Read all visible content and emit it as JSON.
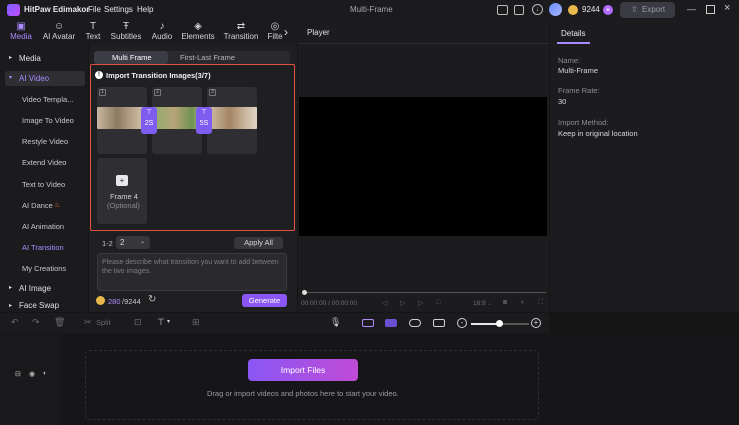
{
  "titlebar": {
    "app_name": "HitPaw Edimakor",
    "menus": [
      "File",
      "Settings",
      "Help"
    ],
    "doc_title": "Multi-Frame",
    "credits": "9244",
    "export_label": "Export"
  },
  "toolbar": {
    "tools": [
      {
        "label": "Media",
        "icon": "media-icon"
      },
      {
        "label": "AI Avatar",
        "icon": "avatar-icon"
      },
      {
        "label": "Text",
        "icon": "text-icon"
      },
      {
        "label": "Subtitles",
        "icon": "subtitles-icon"
      },
      {
        "label": "Audio",
        "icon": "audio-icon"
      },
      {
        "label": "Elements",
        "icon": "elements-icon"
      },
      {
        "label": "Transition",
        "icon": "transition-icon"
      },
      {
        "label": "Filte",
        "icon": "filter-icon"
      }
    ]
  },
  "sidebar": {
    "categories": [
      "Media",
      "AI Video",
      "AI Image",
      "Face Swap"
    ],
    "items": [
      "Video Templa...",
      "Image To Video",
      "Restyle Video",
      "Extend Video",
      "Text to Video",
      "AI Dance",
      "AI Animation",
      "AI Transition",
      "My Creations"
    ]
  },
  "panel": {
    "tabs": [
      "Multi Frame",
      "First-Last Frame"
    ],
    "import_title": "Import Transition Images(3/7)",
    "frames": [
      {
        "number": "1"
      },
      {
        "number": "2"
      },
      {
        "number": "3"
      }
    ],
    "durations": [
      "2S",
      "5S"
    ],
    "frame4_label": "Frame 4",
    "frame4_sub": "(Optional)",
    "range_label": "1-2",
    "range_value": "2",
    "apply_all": "Apply All",
    "prompt_placeholder": "Please describe what transition you want to add between the two images.",
    "credits_used": "280",
    "credits_total": "/9244",
    "generate_label": "Generate"
  },
  "player": {
    "title": "Player",
    "time": "00:00:00 / 00:00:00",
    "ratio": "16:9"
  },
  "details": {
    "tab": "Details",
    "name_label": "Name:",
    "name_value": "Multi-Frame",
    "fps_label": "Frame Rate:",
    "fps_value": "30",
    "import_label": "Import Method:",
    "import_value": "Keep in original location"
  },
  "timeline": {
    "split_label": "Split",
    "import_button": "Import Files",
    "hint": "Drag or import videos and photos here to start your video."
  }
}
